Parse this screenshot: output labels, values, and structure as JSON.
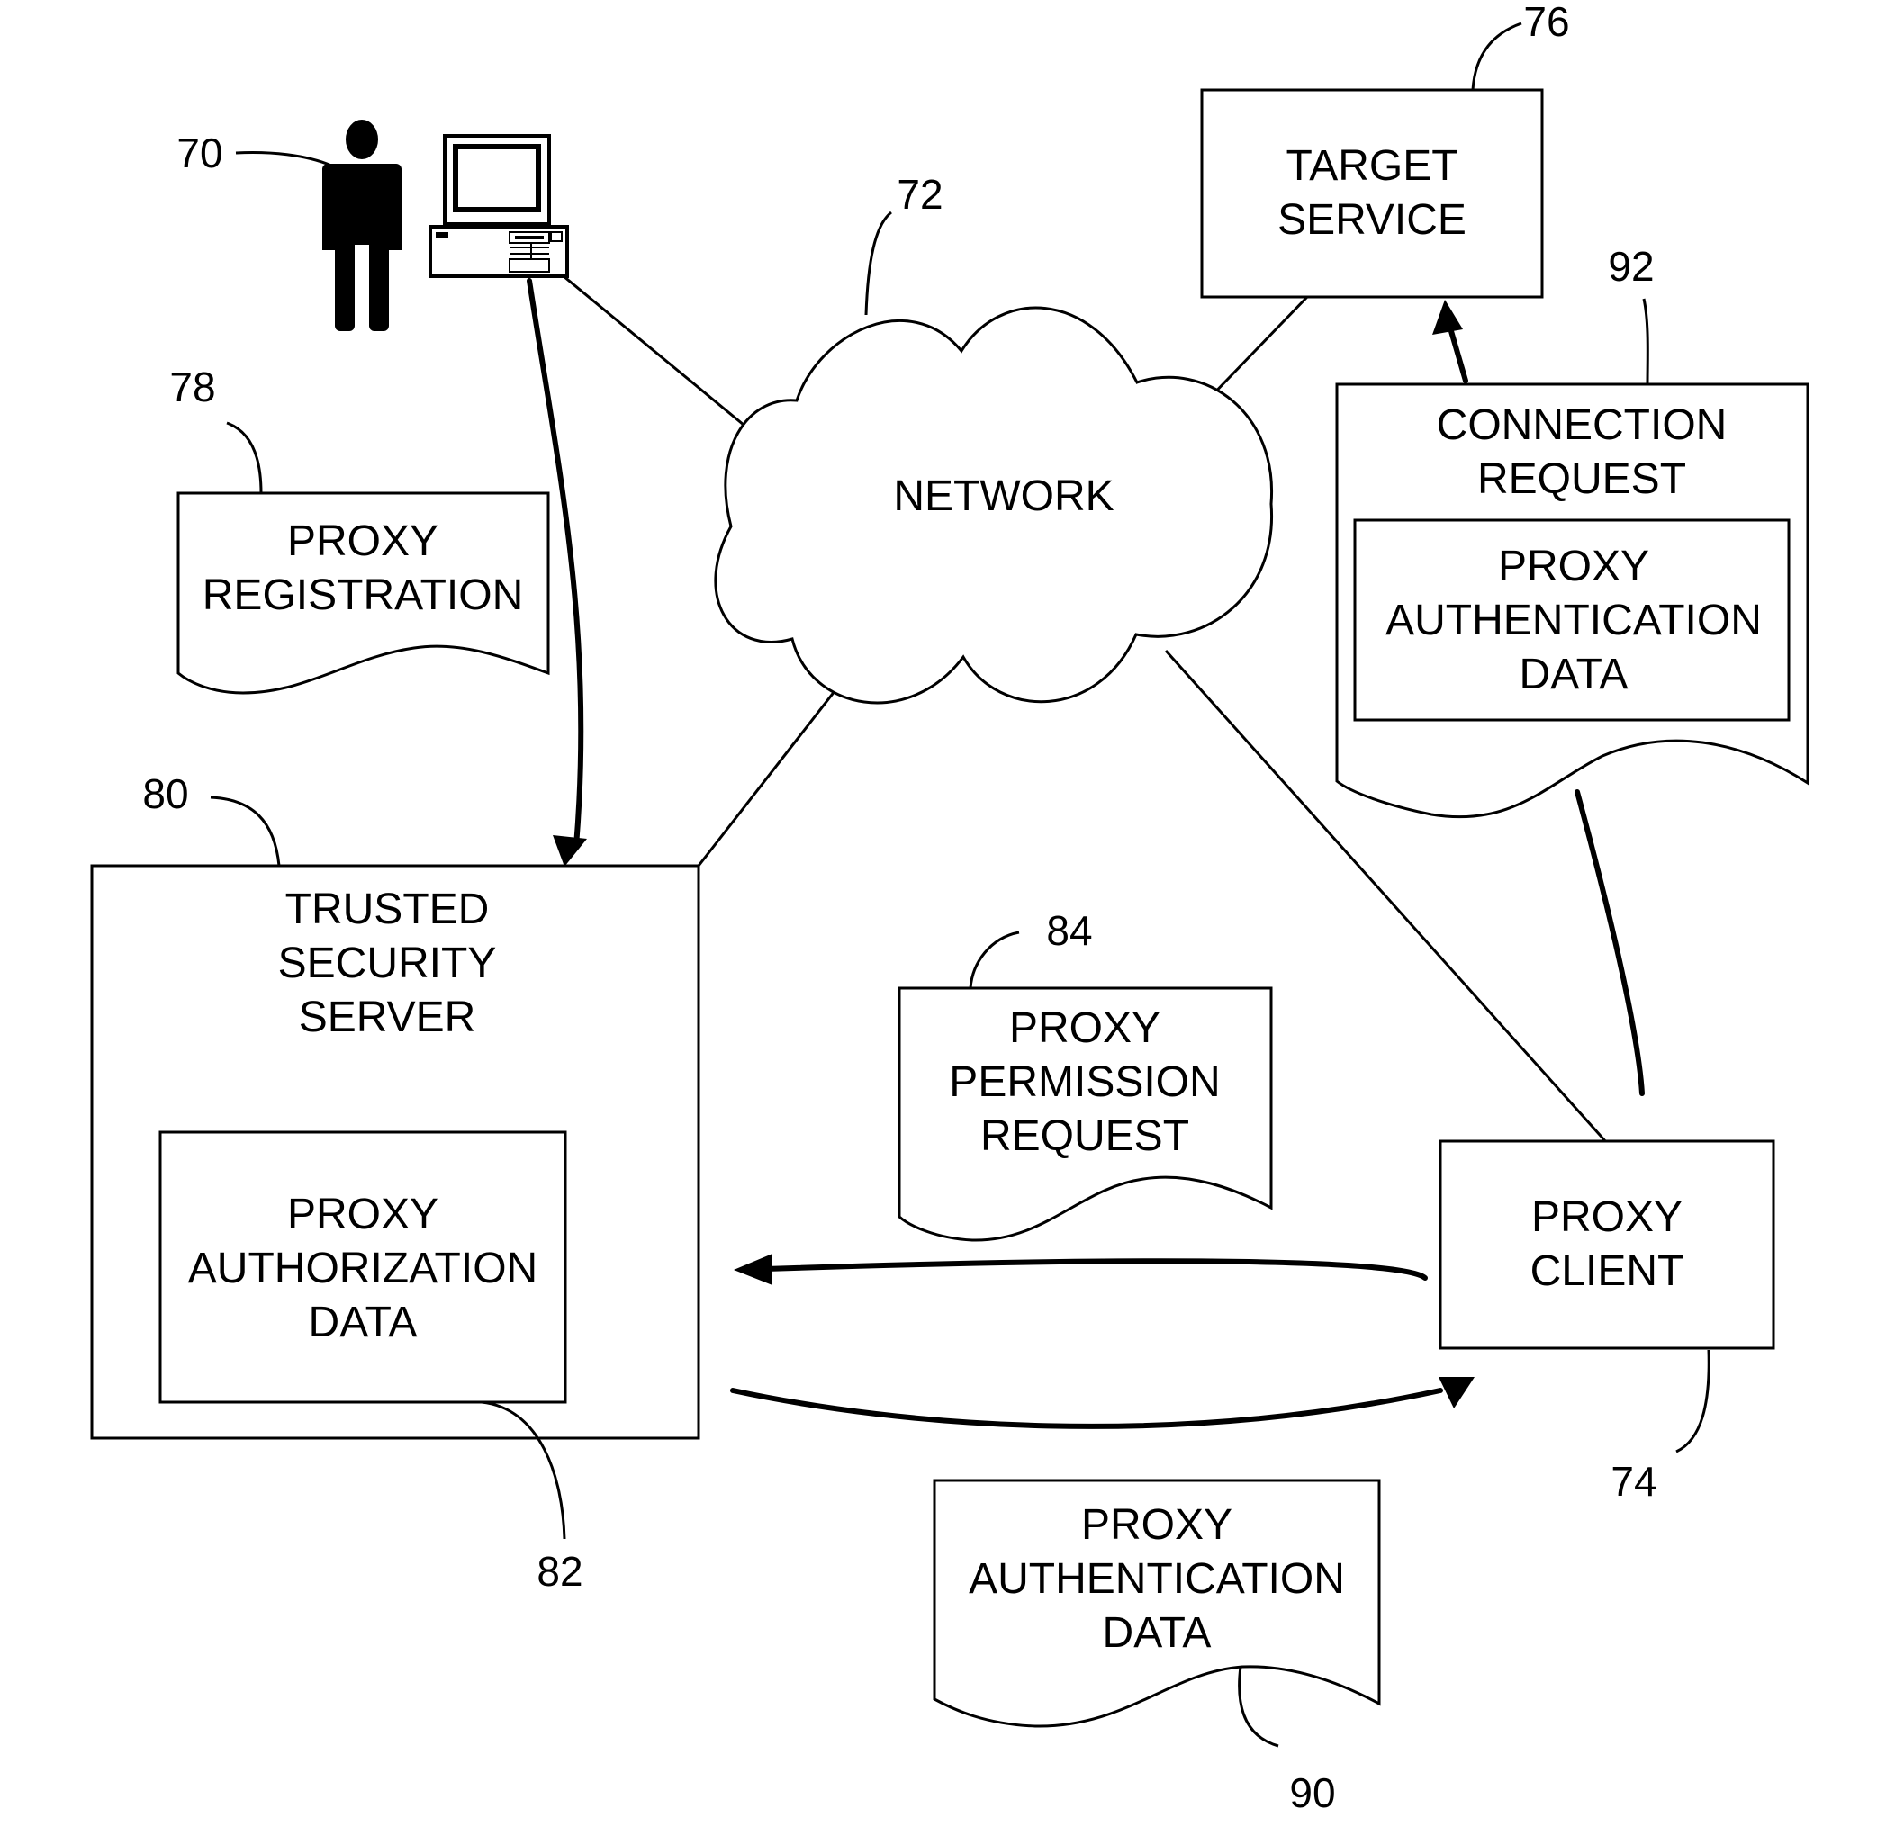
{
  "diagram": {
    "nodes": {
      "user": {
        "ref": "70",
        "icon": "person-icon"
      },
      "computer": {
        "icon": "computer-icon"
      },
      "network": {
        "ref": "72",
        "label": [
          "NETWORK"
        ]
      },
      "target_service": {
        "ref": "76",
        "label": [
          "TARGET",
          "SERVICE"
        ]
      },
      "proxy_registration": {
        "ref": "78",
        "label": [
          "PROXY",
          "REGISTRATION"
        ]
      },
      "trusted_security_server": {
        "ref": "80",
        "label": [
          "TRUSTED",
          "SECURITY",
          "SERVER"
        ]
      },
      "proxy_authorization_data": {
        "ref": "82",
        "label": [
          "PROXY",
          "AUTHORIZATION",
          "DATA"
        ]
      },
      "proxy_permission_request": {
        "ref": "84",
        "label": [
          "PROXY",
          "PERMISSION",
          "REQUEST"
        ]
      },
      "proxy_client": {
        "ref": "74",
        "label": [
          "PROXY",
          "CLIENT"
        ]
      },
      "proxy_authentication_data": {
        "ref": "90",
        "label": [
          "PROXY",
          "AUTHENTICATION",
          "DATA"
        ]
      },
      "connection_request": {
        "ref": "92",
        "label": [
          "CONNECTION",
          "REQUEST"
        ]
      },
      "connection_request_auth_data": {
        "label": [
          "PROXY",
          "AUTHENTICATION",
          "DATA"
        ]
      }
    },
    "edges": [
      {
        "from": "computer",
        "to": "network",
        "type": "line"
      },
      {
        "from": "target_service",
        "to": "network",
        "type": "line"
      },
      {
        "from": "network",
        "to": "trusted_security_server",
        "type": "line"
      },
      {
        "from": "network",
        "to": "proxy_client",
        "type": "line"
      },
      {
        "from": "computer",
        "to": "trusted_security_server",
        "type": "arrow",
        "carries": "proxy_registration"
      },
      {
        "from": "proxy_client",
        "to": "trusted_security_server",
        "type": "arrow",
        "carries": "proxy_permission_request"
      },
      {
        "from": "trusted_security_server",
        "to": "proxy_client",
        "type": "arrow",
        "carries": "proxy_authentication_data"
      },
      {
        "from": "proxy_client",
        "to": "target_service",
        "type": "arrow",
        "carries": "connection_request"
      }
    ]
  }
}
